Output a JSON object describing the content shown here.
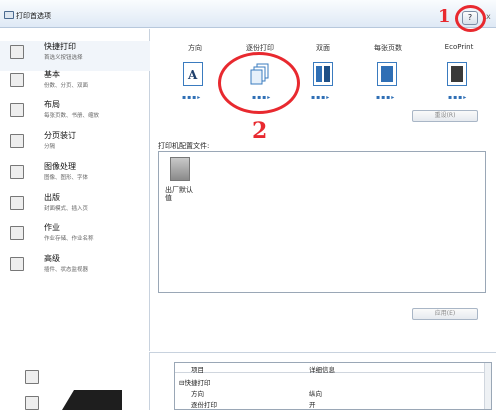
{
  "window": {
    "title": "打印首选项",
    "help_label": "?",
    "close_label": "x"
  },
  "callouts": [
    "1",
    "2"
  ],
  "sidebar": {
    "items": [
      {
        "label": "快捷打印",
        "desc": "首选义按钮选择"
      },
      {
        "label": "基本",
        "desc": "份数、分页、双面"
      },
      {
        "label": "布局",
        "desc": "每张页数、书册、缩放"
      },
      {
        "label": "分页装订",
        "desc": "分隔"
      },
      {
        "label": "图像处理",
        "desc": "图像、图形、字体"
      },
      {
        "label": "出版",
        "desc": "封面模式、插入页"
      },
      {
        "label": "作业",
        "desc": "作业存储、作业名称"
      },
      {
        "label": "高级",
        "desc": "插件、状态监视器"
      }
    ]
  },
  "tabs": [
    {
      "label": "方向",
      "icon": "orientation-icon"
    },
    {
      "label": "逐份打印",
      "icon": "collate-icon"
    },
    {
      "label": "双面",
      "icon": "duplex-icon"
    },
    {
      "label": "每张页数",
      "icon": "pages-per-sheet-icon"
    },
    {
      "label": "EcoPrint",
      "icon": "ecoprint-icon"
    }
  ],
  "tab_dots": "▪▪▪▸",
  "reset_label": "重设(R)",
  "profiles_label": "打印机配置文件:",
  "profile_name": "出厂默认值",
  "apply_label": "应用(E)",
  "details": {
    "col_item": "项目",
    "col_detail": "详细信息",
    "rows": [
      {
        "item": "⊟快捷打印",
        "detail": ""
      },
      {
        "item": "方向",
        "detail": "纵向"
      },
      {
        "item": "逐份打印",
        "detail": "开"
      }
    ]
  },
  "colors": {
    "accent": "#2f6fb5",
    "callout": "#e8292f"
  }
}
